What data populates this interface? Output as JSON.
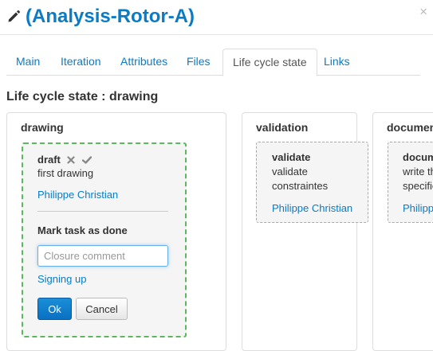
{
  "header": {
    "title": "(Analysis-Rotor-A)",
    "close_label": "×"
  },
  "tabs": [
    {
      "label": "Main"
    },
    {
      "label": "Iteration"
    },
    {
      "label": "Attributes"
    },
    {
      "label": "Files"
    },
    {
      "label": "Life cycle state",
      "active": true
    },
    {
      "label": "Links"
    }
  ],
  "section": {
    "title_prefix": "Life cycle state :",
    "title_state": "drawing"
  },
  "columns": [
    {
      "title": "drawing",
      "task": {
        "name": "draft",
        "description": "first drawing",
        "assignee": "Philippe Christian",
        "mark_done_label": "Mark task as done",
        "closure_placeholder": "Closure comment",
        "signing_link": "Signing up",
        "ok_label": "Ok",
        "cancel_label": "Cancel"
      }
    },
    {
      "title": "validation",
      "task": {
        "name": "validate",
        "description_line1": "validate",
        "description_line2": "constraintes",
        "assignee": "Philippe Christian"
      }
    },
    {
      "title": "documen",
      "task": {
        "name": "docum",
        "description_line1": "write th",
        "description_line2": "specific",
        "assignee": "Philipp"
      }
    }
  ],
  "colors": {
    "brand_blue": "#0a7bc5",
    "active_border": "#5cb85c",
    "ok_button": "#0a6fc2"
  }
}
